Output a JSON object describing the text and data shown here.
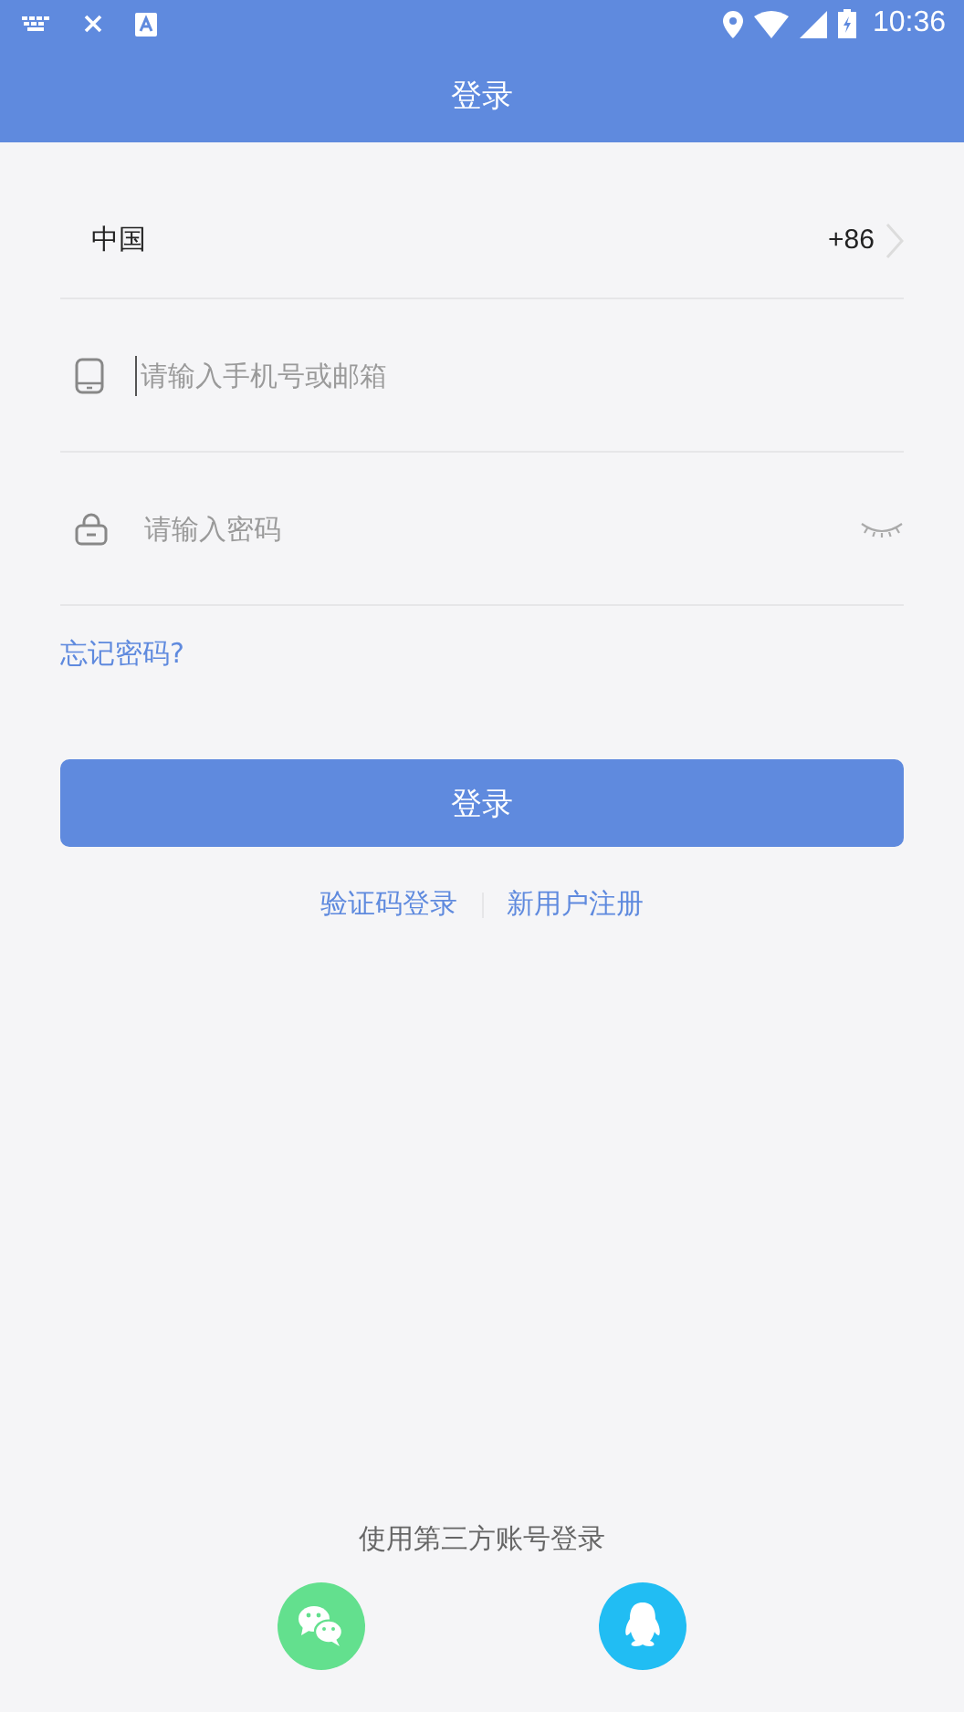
{
  "status_bar": {
    "time": "10:36"
  },
  "header": {
    "title": "登录"
  },
  "country": {
    "name": "中国",
    "code": "+86"
  },
  "fields": [
    {
      "kind": "phone",
      "placeholder": "请输入手机号或邮箱",
      "focused": true
    },
    {
      "kind": "password",
      "placeholder": "请输入密码",
      "focused": false
    }
  ],
  "forgot_link": "忘记密码?",
  "login_button": "登录",
  "links": [
    "验证码登录",
    "新用户注册"
  ],
  "third_party": {
    "label": "使用第三方账号登录"
  }
}
